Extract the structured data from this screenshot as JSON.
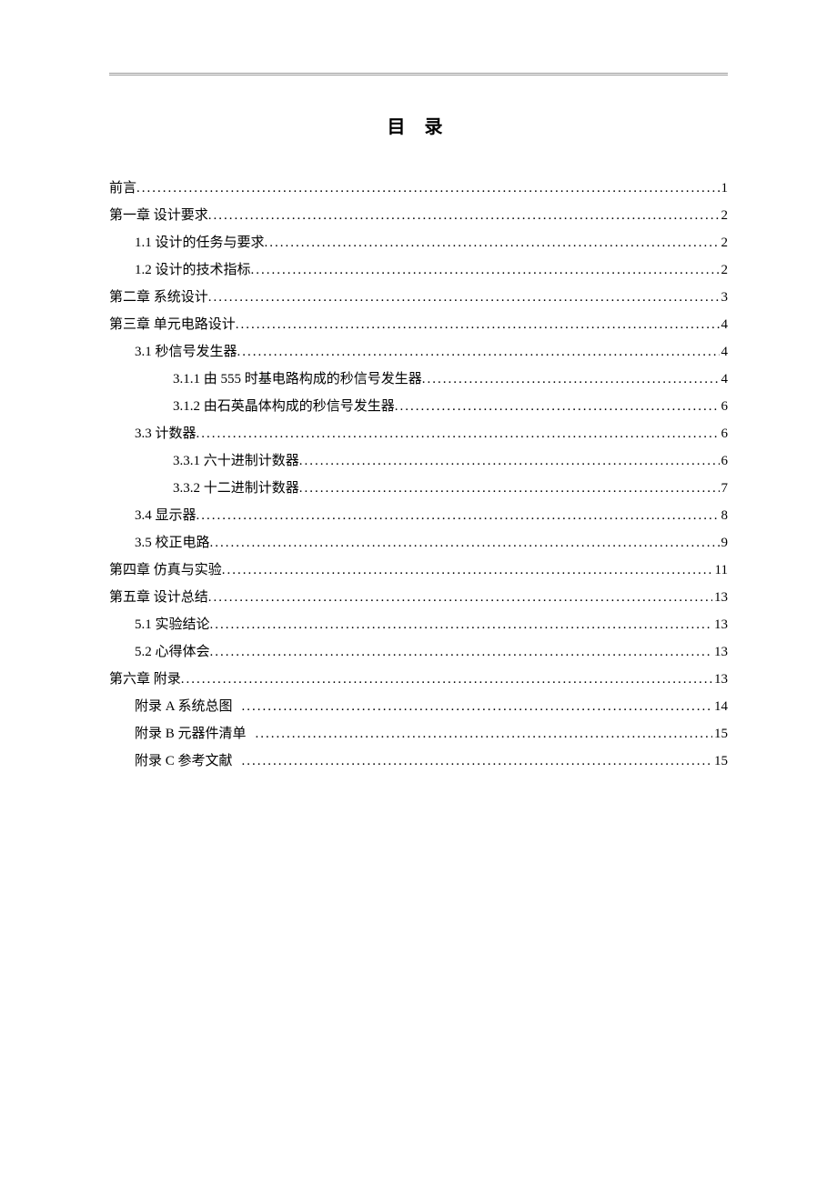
{
  "title": "目 录",
  "entries": [
    {
      "indent": 0,
      "label": "前言",
      "page": "1"
    },
    {
      "indent": 0,
      "label": "第一章   设计要求",
      "page": "2"
    },
    {
      "indent": 1,
      "label": "1.1 设计的任务与要求",
      "page": "2"
    },
    {
      "indent": 1,
      "label": "1.2 设计的技术指标",
      "page": "2"
    },
    {
      "indent": 0,
      "label": "第二章   系统设计",
      "page": "3"
    },
    {
      "indent": 0,
      "label": "第三章   单元电路设计",
      "page": "4"
    },
    {
      "indent": 2,
      "label": "3.1   秒信号发生器",
      "page": "4"
    },
    {
      "indent": 3,
      "label": "3.1.1  由 555 时基电路构成的秒信号发生器",
      "page": "4"
    },
    {
      "indent": 3,
      "label": "3.1.2  由石英晶体构成的秒信号发生器",
      "page": "6"
    },
    {
      "indent": 2,
      "label": "3.3  计数器",
      "page": "6"
    },
    {
      "indent": 3,
      "label": "3.3.1  六十进制计数器",
      "page": "6"
    },
    {
      "indent": 3,
      "label": "3.3.2  十二进制计数器",
      "page": "7"
    },
    {
      "indent": 2,
      "label": "3.4  显示器",
      "page": "8"
    },
    {
      "indent": 2,
      "label": "3.5  校正电路",
      "page": "9"
    },
    {
      "indent": 0,
      "label": "第四章   仿真与实验",
      "page": "11"
    },
    {
      "indent": 0,
      "label": "第五章   设计总结",
      "page": "13"
    },
    {
      "indent": 2,
      "label": "5.1  实验结论",
      "page": "13"
    },
    {
      "indent": 2,
      "label": "5.2 心得体会",
      "page": "13"
    },
    {
      "indent": 0,
      "label": "第六章   附录",
      "page": "13"
    },
    {
      "indent": 2,
      "label": "附录 A   系统总图",
      "page": "14"
    },
    {
      "indent": 2,
      "label": "附录 B   元器件清单",
      "page": "15"
    },
    {
      "indent": 2,
      "label": "附录 C   参考文献",
      "page": "15"
    }
  ]
}
